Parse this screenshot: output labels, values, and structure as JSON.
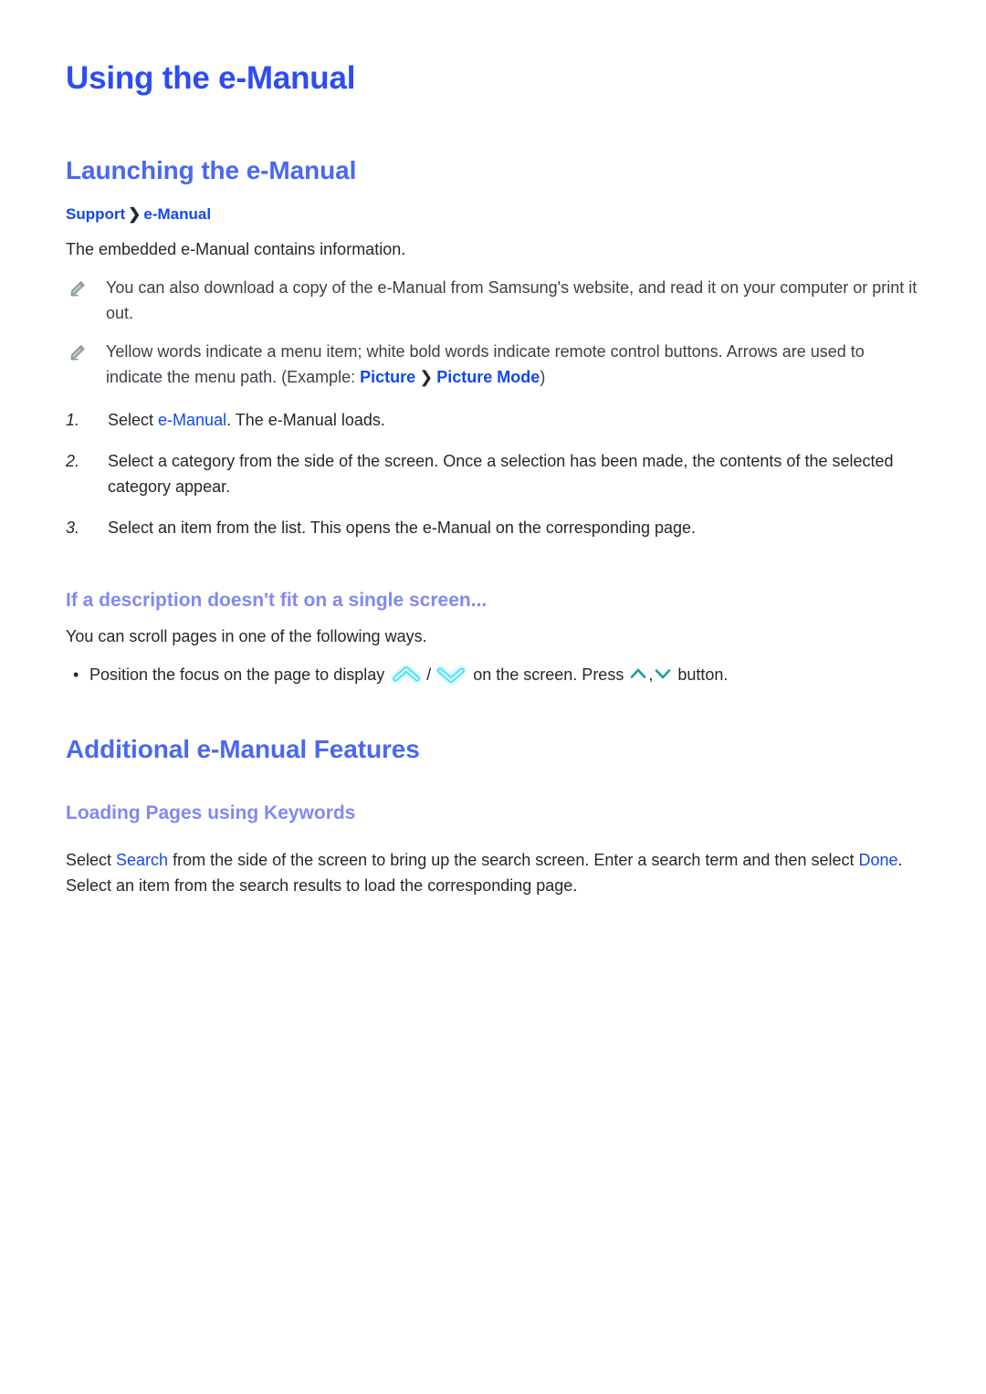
{
  "document": {
    "title": "Using the e-Manual"
  },
  "sections": {
    "launching": {
      "heading": "Launching the e-Manual",
      "breadcrumb": {
        "root": "Support",
        "separator": "❯",
        "leaf": "e-Manual"
      },
      "intro": "The embedded e-Manual contains information.",
      "notes": [
        {
          "icon": "pencil-icon",
          "text": "You can also download a copy of the e-Manual from Samsung's website, and read it on your computer or print it out."
        },
        {
          "icon": "pencil-icon",
          "text_before": "Yellow words indicate a menu item; white bold words indicate remote control buttons. Arrows are used to indicate the menu path. (Example: ",
          "link_1": "Picture",
          "separator": "❯",
          "link_2": "Picture Mode",
          "text_after": ")"
        }
      ],
      "steps": [
        {
          "number": "1.",
          "text_before": "Select ",
          "link": "e-Manual",
          "text_after": ". The e-Manual loads."
        },
        {
          "number": "2.",
          "text_before": "Select a category from the side of the screen. Once a selection has been made, the contents of the selected category appear.",
          "link": "",
          "text_after": ""
        },
        {
          "number": "3.",
          "text_before": "Select an item from the list. This opens the e-Manual on the corresponding page.",
          "link": "",
          "text_after": ""
        }
      ],
      "subsection": {
        "heading": "If a description doesn't fit on a single screen...",
        "intro": "You can scroll pages in one of the following ways.",
        "bullet": {
          "marker": "•",
          "text_1": "Position the focus on the page to display ",
          "icon_up": "chevron-up-glow-icon",
          "slash": "/",
          "icon_down": "chevron-down-glow-icon",
          "text_2": " on the screen. Press ",
          "icon_press_up": "chevron-up-icon",
          "comma": ",",
          "icon_press_down": "chevron-down-icon",
          "text_3": " button."
        }
      }
    },
    "additional": {
      "heading": "Additional e-Manual Features",
      "subsection": {
        "heading": "Loading Pages using Keywords",
        "text_before": "Select ",
        "link_1": "Search",
        "text_middle": " from the side of the screen to bring up the search screen. Enter a search term and then select ",
        "link_2": "Done",
        "text_after": ". Select an item from the search results to load the corresponding page."
      }
    }
  },
  "colors": {
    "title_blue": "#2d4cf5",
    "heading_blue": "#4a68f0",
    "subheading_periwinkle": "#8189f0",
    "link_blue": "#1148f0",
    "body_text": "#23282d",
    "note_text": "#3a4148",
    "pencil_gray": "#8c9a9a",
    "chevron_glow_cyan": "#4ee8f5",
    "chevron_press_teal": "#1b9e9e"
  }
}
